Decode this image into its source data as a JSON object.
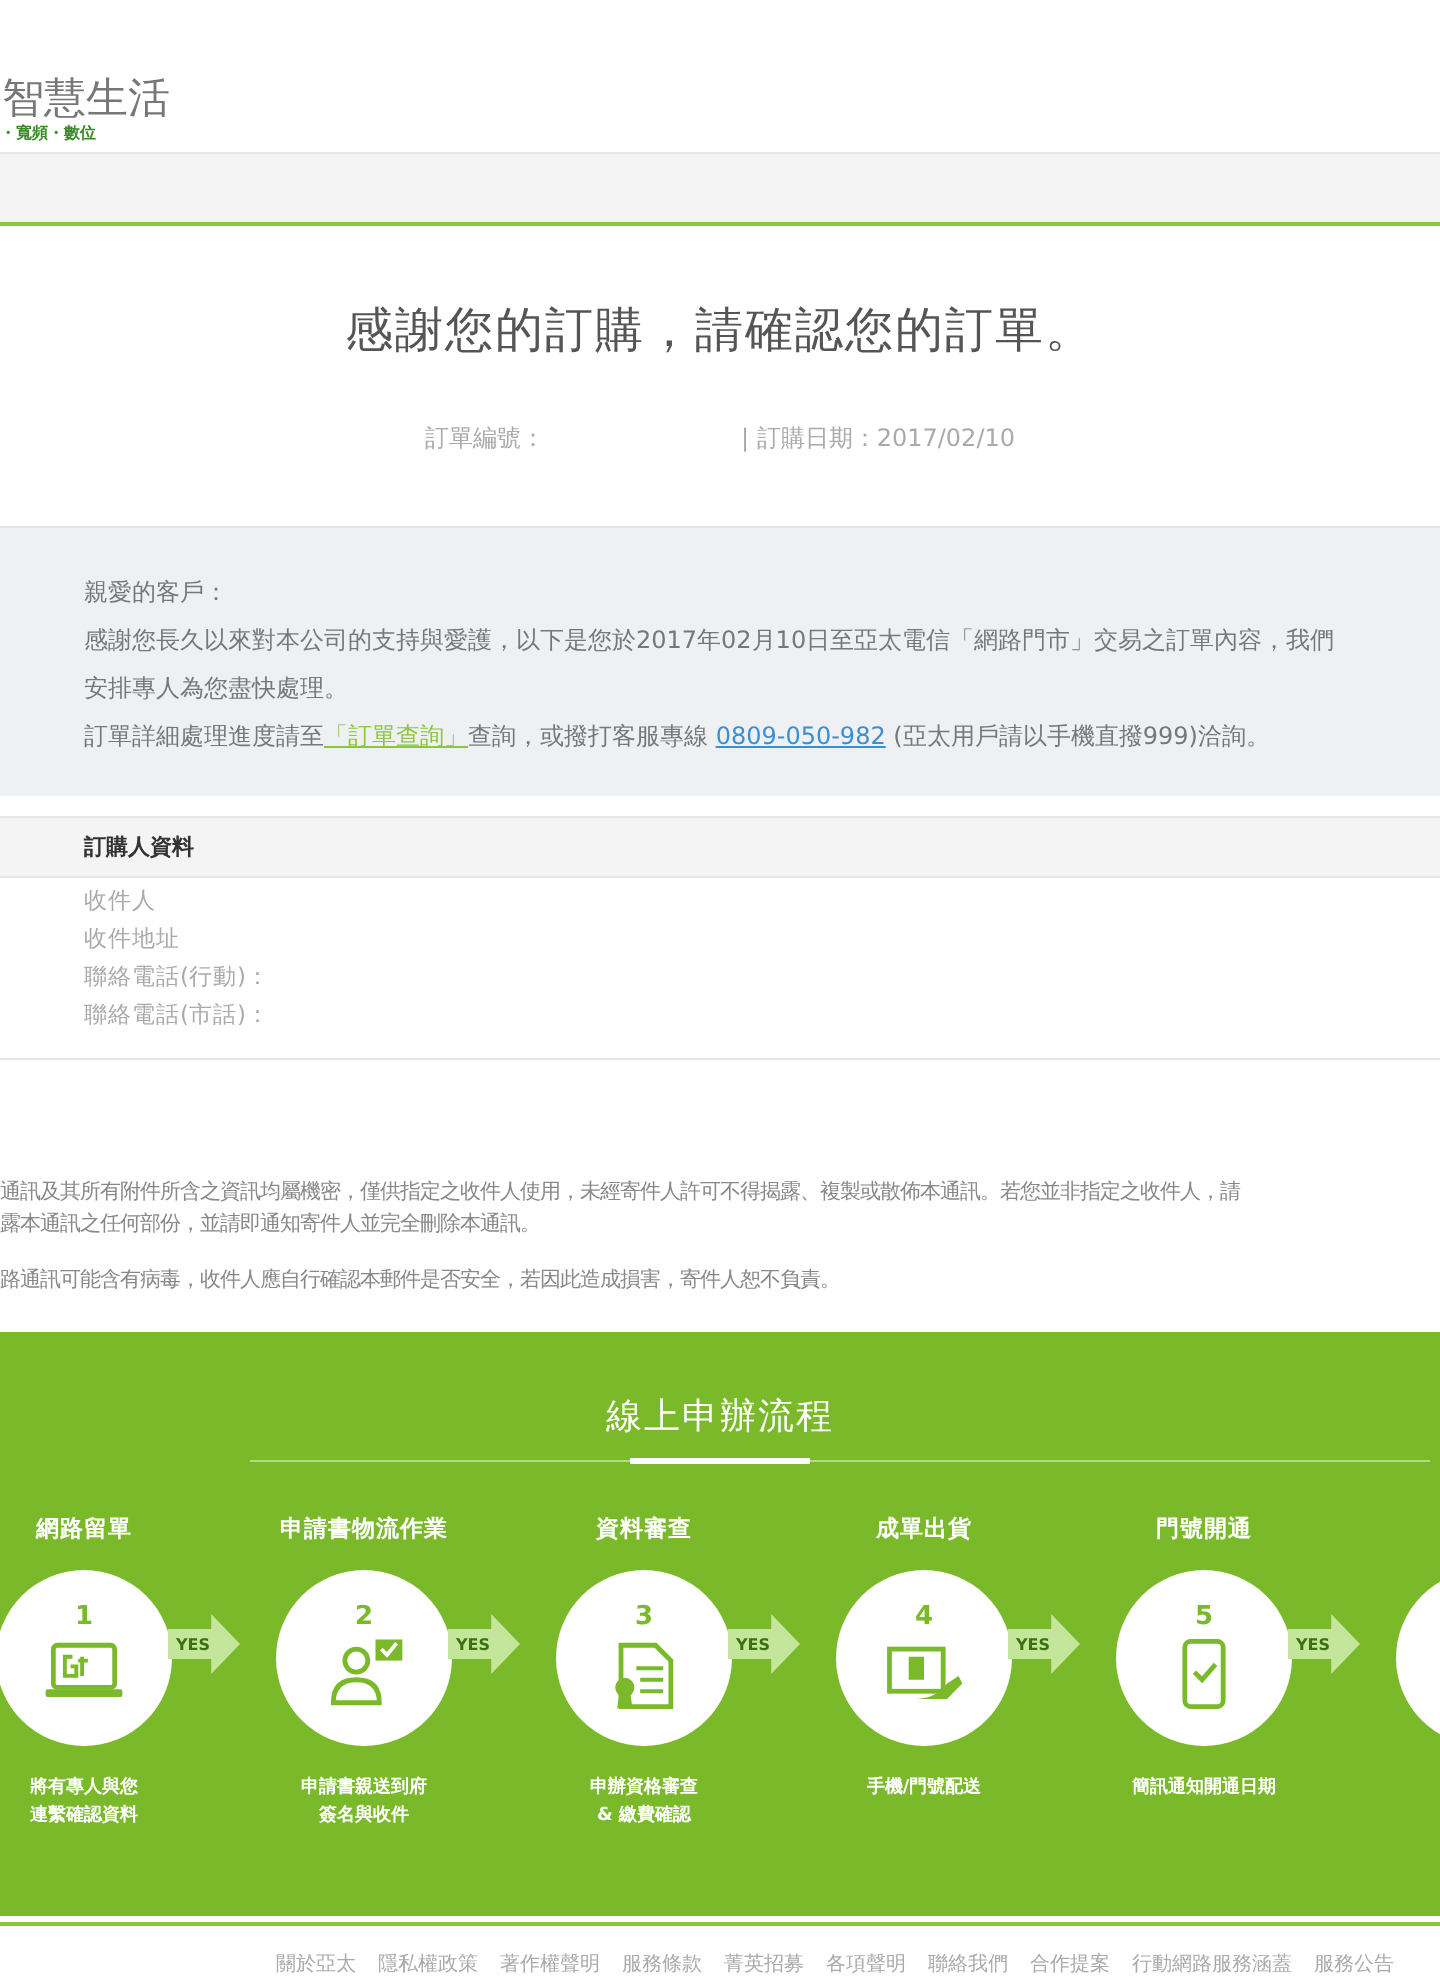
{
  "logo": {
    "title": "智慧生活",
    "tagline": "・寬頻・數位"
  },
  "heading": {
    "title": "感謝您的訂購，請確認您的訂單。",
    "order_label": "訂單編號：",
    "order_date": "| 訂購日期：2017/02/10"
  },
  "notice": {
    "greeting": "親愛的客戶：",
    "lines": [
      "感謝您長久以來對本公司的支持與愛護，以下是您於2017年02月10日至亞太電信「網路門市」交易之訂單內容，我們",
      "安排專人為您盡快處理。"
    ],
    "query_prefix": "訂單詳細處理進度請至",
    "query_link": "「訂單查詢」",
    "query_middle": "查詢，或撥打客服專線",
    "phone_link": "0809-050-982",
    "query_suffix": "(亞太用戶請以手機直撥999)洽詢。"
  },
  "buyer": {
    "title": "訂購人資料",
    "fields": [
      "收件人",
      "收件地址",
      "聯絡電話(行動)：",
      "聯絡電話(市話)："
    ]
  },
  "disclaimer": [
    "通訊及其所有附件所含之資訊均屬機密，僅供指定之收件人使用，未經寄件人許可不得揭露、複製或散佈本通訊。若您並非指定之收件人，請",
    "露本通訊之任何部份，並請即通知寄件人並完全刪除本通訊。",
    "路通訊可能含有病毒，收件人應自行確認本郵件是否安全，若因此造成損害，寄件人恕不負責。"
  ],
  "process": {
    "title": "線上申辦流程",
    "steps": [
      {
        "kind": "laptop",
        "title": "網路留單",
        "number": "1",
        "arrow": "YES",
        "desc": [
          "將有專人與您",
          "連繫確認資料"
        ]
      },
      {
        "kind": "person",
        "title": "申請書物流作業",
        "number": "2",
        "arrow": "YES",
        "desc": [
          "申請書親送到府",
          "簽名與收件"
        ]
      },
      {
        "kind": "document",
        "title": "資料審查",
        "number": "3",
        "arrow": "YES",
        "desc": [
          "申辦資格審查",
          "& 繳費確認"
        ]
      },
      {
        "kind": "parcel",
        "title": "成單出貨",
        "number": "4",
        "arrow": "YES",
        "desc": [
          "手機/門號配送"
        ]
      },
      {
        "kind": "phone",
        "title": "門號開通",
        "number": "5",
        "arrow": "YES",
        "desc": [
          "簡訊通知開通日期"
        ]
      }
    ]
  },
  "footer_links": [
    "關於亞太",
    "隱私權政策",
    "著作權聲明",
    "服務條款",
    "菁英招募",
    "各項聲明",
    "聯絡我們",
    "合作提案",
    "行動網路服務涵蓋",
    "服務公告"
  ]
}
